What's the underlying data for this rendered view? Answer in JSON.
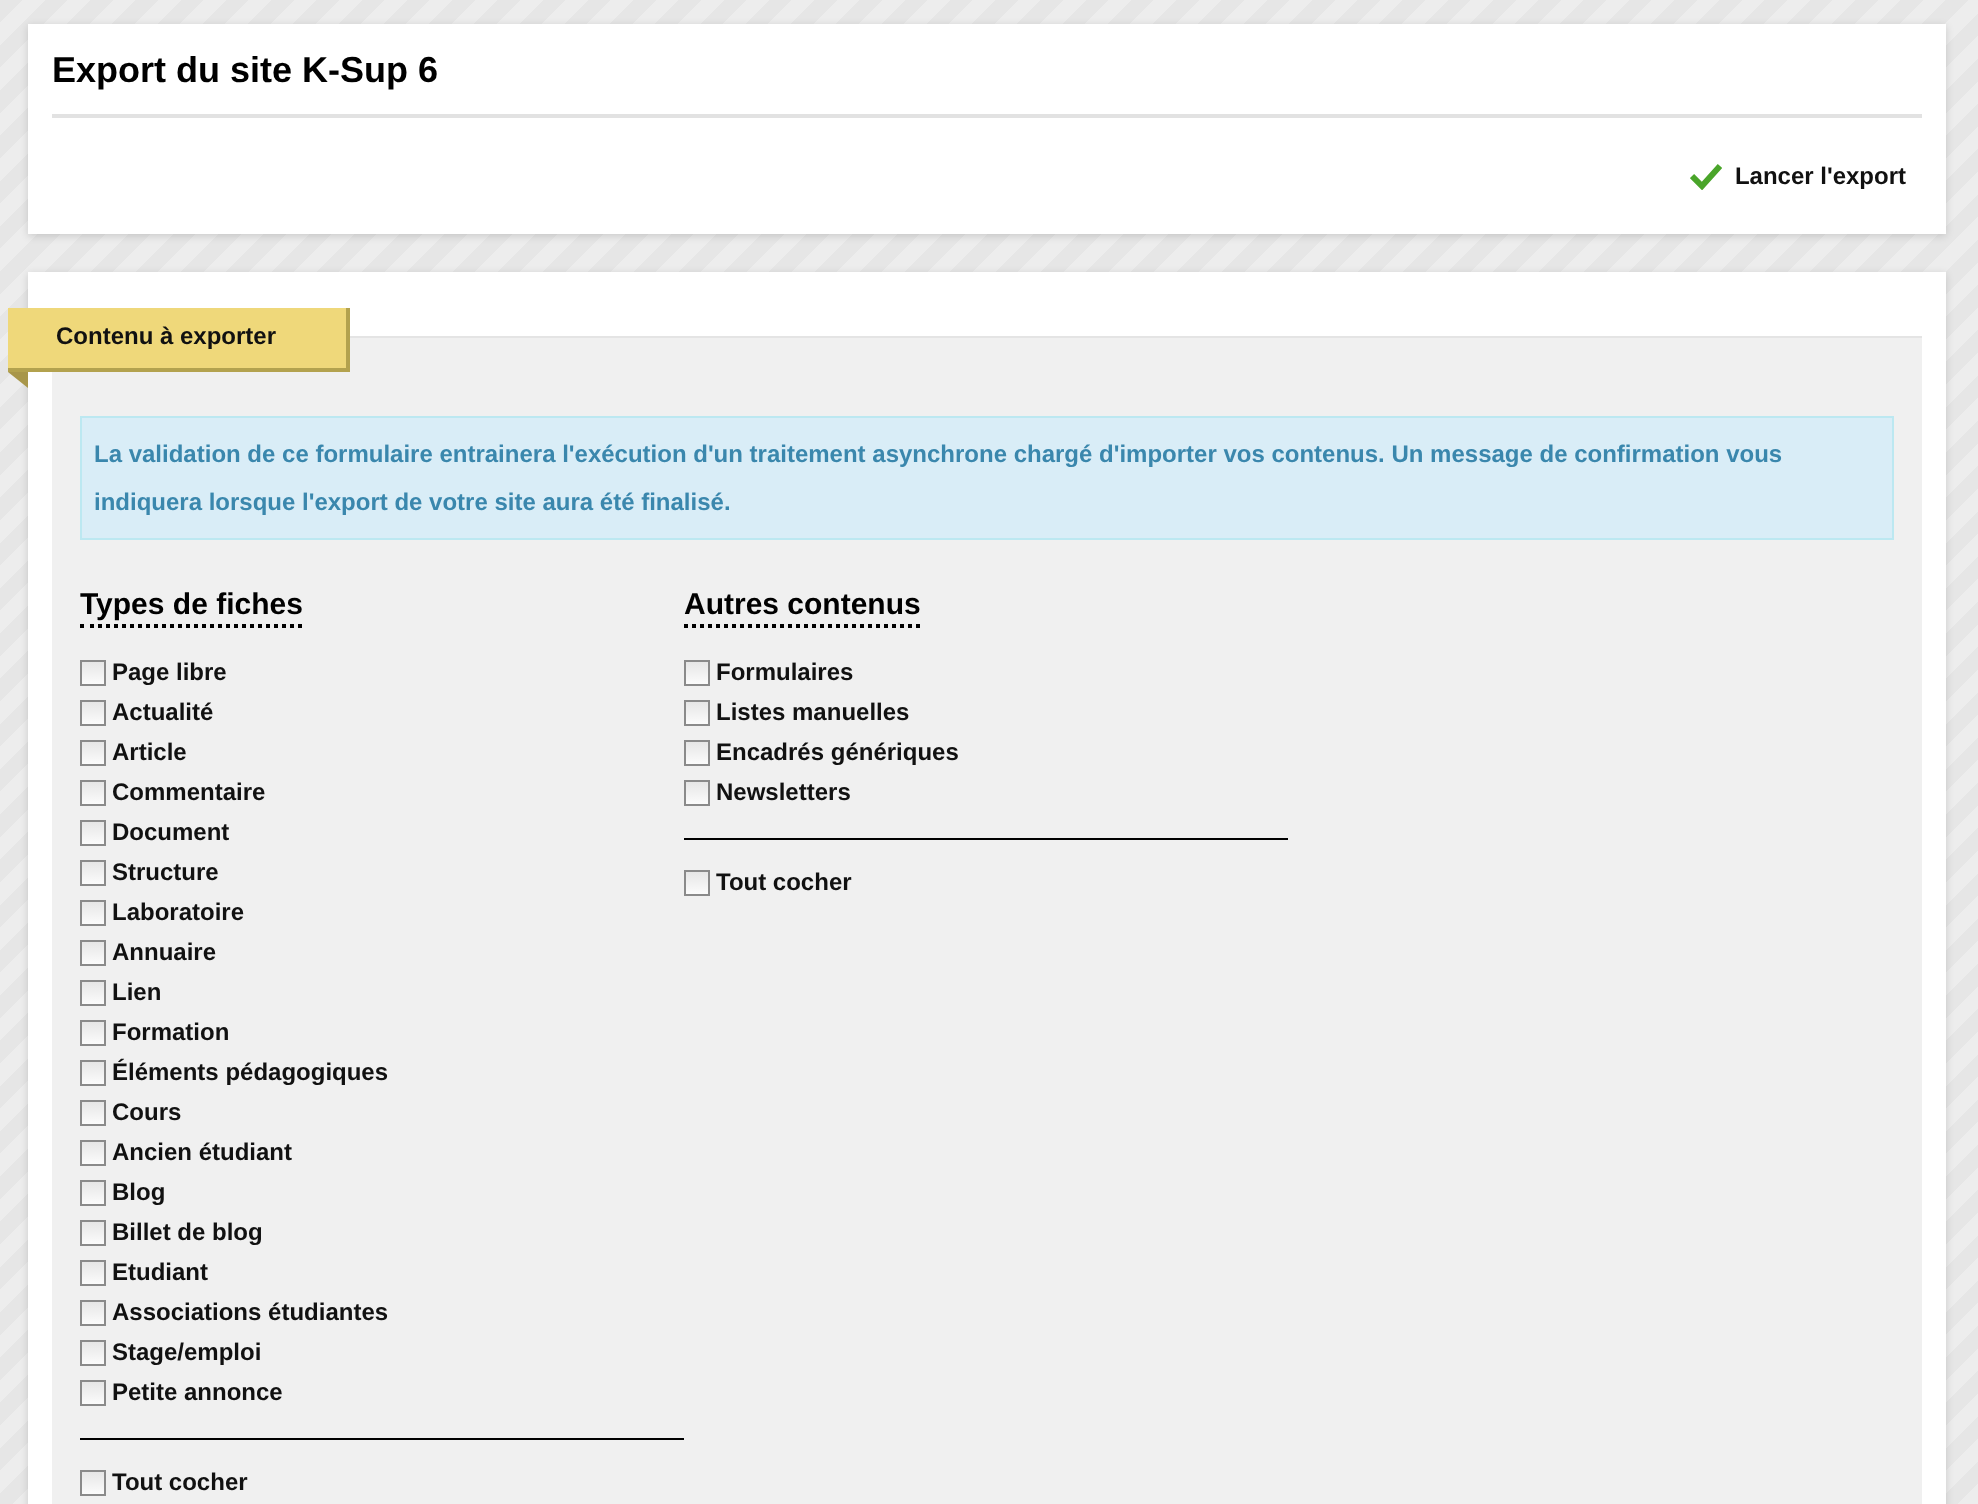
{
  "header": {
    "title": "Export du site K-Sup 6",
    "action": "Lancer l'export"
  },
  "section": {
    "tab": "Contenu à exporter",
    "info": "La validation de ce formulaire entrainera l'exécution d'un traitement asynchrone chargé d'importer vos contenus. Un message de confirmation vous indiquera lorsque l'export de votre site aura été finalisé.",
    "groups": [
      {
        "title": "Types de fiches",
        "items": [
          {
            "label": "Page libre",
            "checked": false
          },
          {
            "label": "Actualité",
            "checked": false
          },
          {
            "label": "Article",
            "checked": false
          },
          {
            "label": "Commentaire",
            "checked": false
          },
          {
            "label": "Document",
            "checked": false
          },
          {
            "label": "Structure",
            "checked": false
          },
          {
            "label": "Laboratoire",
            "checked": false
          },
          {
            "label": "Annuaire",
            "checked": false
          },
          {
            "label": "Lien",
            "checked": false
          },
          {
            "label": "Formation",
            "checked": false
          },
          {
            "label": "Éléments pédagogiques",
            "checked": false
          },
          {
            "label": "Cours",
            "checked": false
          },
          {
            "label": "Ancien étudiant",
            "checked": false
          },
          {
            "label": "Blog",
            "checked": false
          },
          {
            "label": "Billet de blog",
            "checked": false
          },
          {
            "label": "Etudiant",
            "checked": false
          },
          {
            "label": "Associations étudiantes",
            "checked": false
          },
          {
            "label": "Stage/emploi",
            "checked": false
          },
          {
            "label": "Petite annonce",
            "checked": false
          }
        ],
        "check_all": {
          "label": "Tout cocher",
          "checked": false
        }
      },
      {
        "title": "Autres contenus",
        "items": [
          {
            "label": "Formulaires",
            "checked": false
          },
          {
            "label": "Listes manuelles",
            "checked": false
          },
          {
            "label": "Encadrés génériques",
            "checked": false
          },
          {
            "label": "Newsletters",
            "checked": false
          }
        ],
        "check_all": {
          "label": "Tout cocher",
          "checked": false
        }
      }
    ]
  }
}
